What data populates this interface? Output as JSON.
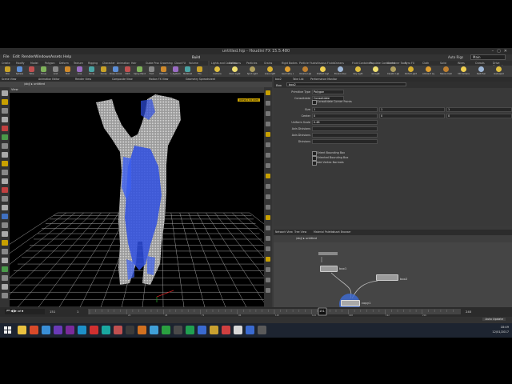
{
  "app": {
    "title": "untitled.hip - Houdini FX 15.5.480",
    "menus": [
      "File",
      "Edit",
      "Render",
      "Windows",
      "Assets",
      "Help"
    ],
    "build_label": "Build",
    "desktop_label": "Auto Rigs",
    "desktop_select": "Main"
  },
  "shelf": {
    "left_tabs": [
      "Create",
      "Modify",
      "Model",
      "Polygon",
      "Deform",
      "Texture",
      "Rigging",
      "Character",
      "Animation",
      "Hair",
      "Guide Proc",
      "Grooming",
      "Cloud FX",
      "Volume"
    ],
    "right_tabs": [
      "Lights and Cameras",
      "Collisions",
      "Particles",
      "Grains",
      "Rigid Bodies",
      "Particle Fluids",
      "Viscous Fluids",
      "Oceans",
      "Fluid Containers",
      "Populate Containers",
      "Container Tools",
      "Pyro FX",
      "Cloth",
      "Solid",
      "Wires",
      "Crowds",
      "Drive Simulation"
    ],
    "left_tools": [
      "Box",
      "Sphere",
      "Tube",
      "Torus",
      "Grid",
      "Null",
      "Line",
      "Circle",
      "Curve",
      "Draw Curve",
      "Path",
      "Spray Paint",
      "Font",
      "Platonic",
      "L-System",
      "Metaball",
      "File"
    ],
    "right_tools": [
      "Camera",
      "Point Light",
      "Spot Light",
      "Area Light",
      "Geometry Light",
      "Volume Light",
      "Distant Light",
      "Environment",
      "Sky Light",
      "GI Light",
      "Caustic Light",
      "Portal Light",
      "Ambient Light",
      "Stereo Camera",
      "VR Camera",
      "Switcher",
      "Gamepad"
    ]
  },
  "left_pane": {
    "tabs": [
      "Scene View",
      "Animation Editor",
      "Render View",
      "Composite View",
      "Motion FX View",
      "Geometry Spreadsheet"
    ],
    "path": "/obj/ ▸ untitled",
    "view_title": "View",
    "camera_label": "persp1  no cam"
  },
  "params": {
    "tabs": [
      "box2",
      "Take List",
      "Performance Monitor"
    ],
    "path": "/obj/box2",
    "node_type": "Box",
    "node_name": "box2",
    "rows": [
      {
        "label": "Primitive Type",
        "value": "Polygon"
      },
      {
        "label": "Consolidate",
        "value": "Consolidate"
      },
      {
        "label": "Size",
        "v1": "1",
        "v2": "1",
        "v3": "1"
      },
      {
        "label": "Center",
        "v1": "0",
        "v2": "0",
        "v3": "0"
      },
      {
        "label": "Uniform Scale",
        "v1": "0.48"
      },
      {
        "label": "Axis Divisions",
        "v1": ""
      },
      {
        "label": "Axis Divisions",
        "v1": ""
      },
      {
        "label": "Divisions",
        "v1": ""
      }
    ],
    "checks": [
      "Consolidate Corner Points",
      "Orient Bounding Box",
      "Oriented Bounding Box",
      "Add Vertex Normals"
    ]
  },
  "network": {
    "tabs": [
      "Network View",
      "Tree View",
      "Material Palette",
      "Asset Browser"
    ],
    "path": "/obj/ ▸ untitled",
    "nodes": [
      {
        "name": "box1"
      },
      {
        "name": "box2"
      },
      {
        "name": "copy1"
      }
    ]
  },
  "timeline": {
    "frame": "151",
    "start": "1",
    "end": "240",
    "ticks": [
      "24",
      "48",
      "72",
      "96",
      "120",
      "144",
      "168",
      "192",
      "216"
    ]
  },
  "status": {
    "right": "Auto Update"
  },
  "taskbar": {
    "time": "18:49",
    "date": "12/01/2017"
  },
  "colors": {
    "node_blue": "#3d6cd6",
    "voxel_gray": "#b0b0b0",
    "grid": "#cccccc"
  }
}
